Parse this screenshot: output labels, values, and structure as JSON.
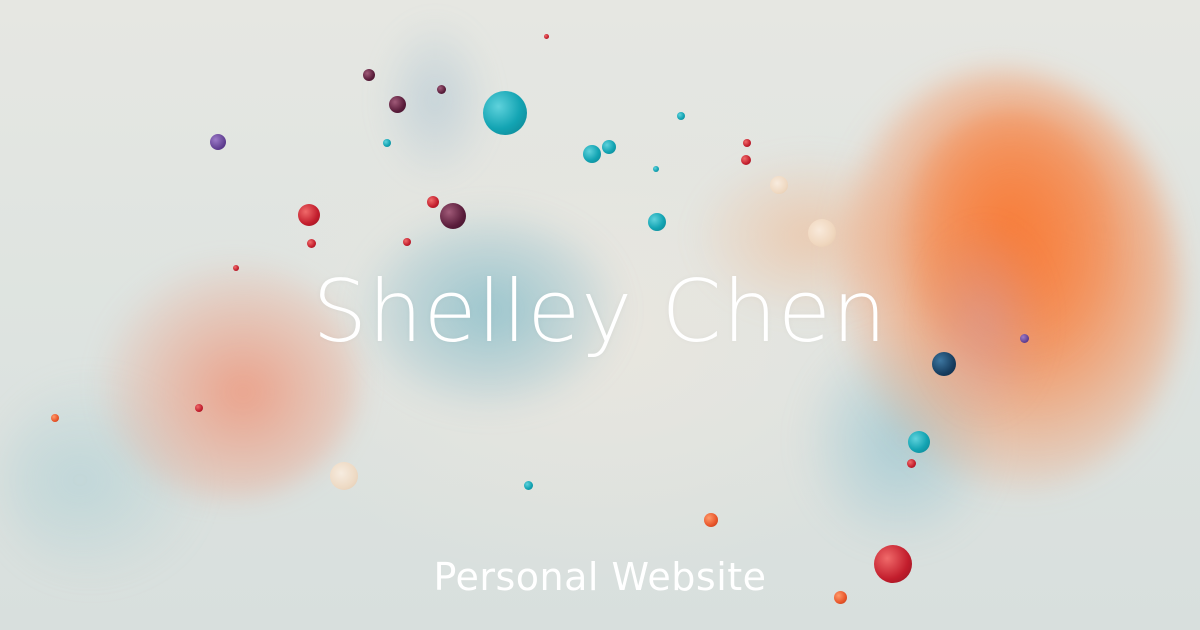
{
  "site": {
    "title": "Shelley Chen",
    "subtitle": "Personal Website"
  },
  "colors": {
    "text": "#ffffff",
    "background": "#e6e7e2",
    "accent_orange": "#f6884a",
    "accent_teal": "#13a4b3",
    "accent_red": "#c21d2c"
  }
}
